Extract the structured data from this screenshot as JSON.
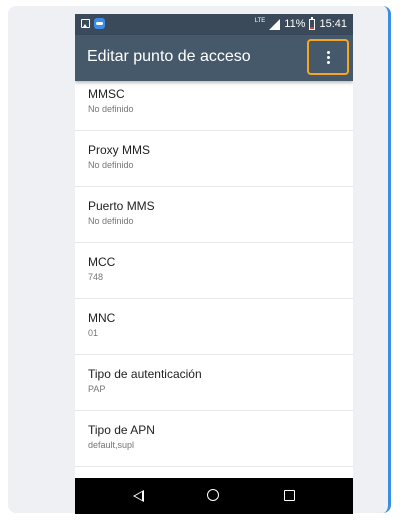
{
  "status_bar": {
    "network": "LTE",
    "battery": "11%",
    "time": "15:41"
  },
  "app_bar": {
    "title": "Editar punto de acceso"
  },
  "items": [
    {
      "title": "MMSC",
      "value": "No definido"
    },
    {
      "title": "Proxy MMS",
      "value": "No definido"
    },
    {
      "title": "Puerto MMS",
      "value": "No definido"
    },
    {
      "title": "MCC",
      "value": "748"
    },
    {
      "title": "MNC",
      "value": "01"
    },
    {
      "title": "Tipo de autenticación",
      "value": "PAP"
    },
    {
      "title": "Tipo de APN",
      "value": "default,supl"
    }
  ],
  "colors": {
    "app_bar": "#46596b",
    "status_bar": "#3a4a5a",
    "highlight": "#f5a623"
  },
  "icons": {
    "menu": "more-vert-icon",
    "back": "back-triangle-icon",
    "home": "home-circle-icon",
    "recent": "recent-square-icon"
  }
}
